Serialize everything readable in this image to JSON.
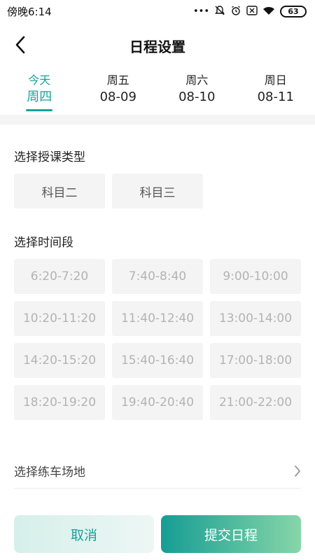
{
  "status_bar": {
    "time": "傍晚6:14",
    "battery": "63",
    "icons": [
      "more-dots-icon",
      "mute-icon",
      "alarm-icon",
      "sim-icon",
      "wifi-icon",
      "battery-icon"
    ]
  },
  "header": {
    "title": "日程设置",
    "back_icon": "chevron-left-icon"
  },
  "day_tabs": [
    {
      "dow": "今天",
      "date": "周四",
      "active": true
    },
    {
      "dow": "周五",
      "date": "08-09",
      "active": false
    },
    {
      "dow": "周六",
      "date": "08-10",
      "active": false
    },
    {
      "dow": "周日",
      "date": "08-11",
      "active": false
    }
  ],
  "lesson_type": {
    "label": "选择授课类型",
    "options": [
      "科目二",
      "科目三"
    ]
  },
  "time_slots": {
    "label": "选择时间段",
    "slots": [
      "6:20-7:20",
      "7:40-8:40",
      "9:00-10:00",
      "10:20-11:20",
      "11:40-12:40",
      "13:00-14:00",
      "14:20-15:20",
      "15:40-16:40",
      "17:00-18:00",
      "18:20-19:20",
      "19:40-20:40",
      "21:00-22:00"
    ]
  },
  "venue": {
    "label": "选择练车场地",
    "icon": "chevron-right-icon"
  },
  "actions": {
    "cancel_label": "取消",
    "submit_label": "提交日程"
  },
  "colors": {
    "accent": "#16a39a",
    "chip_bg": "#f4f4f4",
    "disabled_text": "#b3b3b3",
    "submit_gradient_end": "#86d6a8"
  }
}
